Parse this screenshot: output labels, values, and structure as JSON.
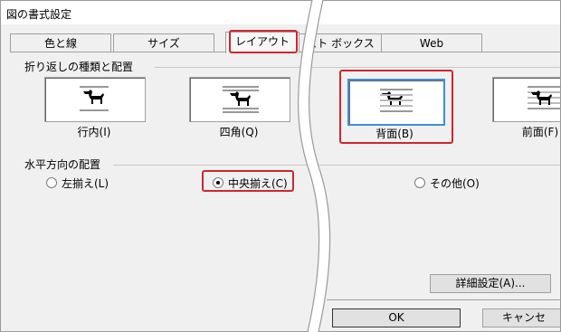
{
  "window": {
    "title": "図の書式設定"
  },
  "tabs": [
    "色と線",
    "サイズ",
    "レイアウト",
    "スト ボックス",
    "Web"
  ],
  "wrap_group": {
    "label": "折り返しの種類と配置",
    "options": [
      "行内(I)",
      "四角(Q)",
      "背面(B)",
      "前面(F)"
    ]
  },
  "horizontal_group": {
    "label": "水平方向の配置",
    "options": [
      "左揃え(L)",
      "中央揃え(C)",
      "その他(O)"
    ]
  },
  "buttons": {
    "advanced": "詳細設定(A)...",
    "ok": "OK",
    "cancel": "キャンセ"
  },
  "colors": {
    "highlight": "#d0262d",
    "selected_border": "#3c8fd8"
  }
}
